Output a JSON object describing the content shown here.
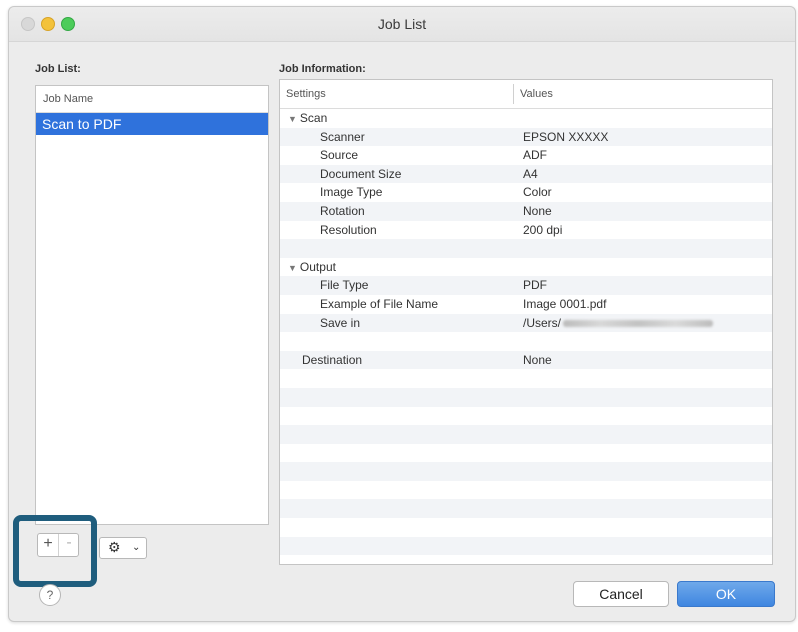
{
  "window": {
    "title": "Job List"
  },
  "job_list": {
    "label": "Job List:",
    "column_header": "Job Name",
    "items": [
      "Scan to PDF"
    ]
  },
  "job_info": {
    "label": "Job Information:",
    "col_settings": "Settings",
    "col_values": "Values",
    "rows": [
      {
        "key": "Scan",
        "value": "",
        "kind": "group"
      },
      {
        "key": "Scanner",
        "value": "EPSON XXXXX",
        "kind": "item"
      },
      {
        "key": "Source",
        "value": "ADF",
        "kind": "item"
      },
      {
        "key": "Document Size",
        "value": "A4",
        "kind": "item"
      },
      {
        "key": "Image Type",
        "value": "Color",
        "kind": "item"
      },
      {
        "key": "Rotation",
        "value": "None",
        "kind": "item"
      },
      {
        "key": "Resolution",
        "value": "200 dpi",
        "kind": "item"
      },
      {
        "key": "",
        "value": "",
        "kind": "blank"
      },
      {
        "key": "Output",
        "value": "",
        "kind": "group"
      },
      {
        "key": "File Type",
        "value": "PDF",
        "kind": "item"
      },
      {
        "key": "Example of File Name",
        "value": "Image 0001.pdf",
        "kind": "item"
      },
      {
        "key": "Save in",
        "value": "/Users/",
        "kind": "blurred"
      },
      {
        "key": "",
        "value": "",
        "kind": "blank"
      },
      {
        "key": "Destination",
        "value": "None",
        "kind": "top"
      }
    ]
  },
  "buttons": {
    "add": "+",
    "remove": "-",
    "gear": "⚙",
    "chevron": "⌄",
    "help": "?",
    "cancel": "Cancel",
    "ok": "OK"
  },
  "colors": {
    "selection": "#2f72dc",
    "ok_button": "#3f86e0",
    "highlight_box": "#1f5d7d"
  },
  "icons": {
    "triangle": "▼"
  }
}
